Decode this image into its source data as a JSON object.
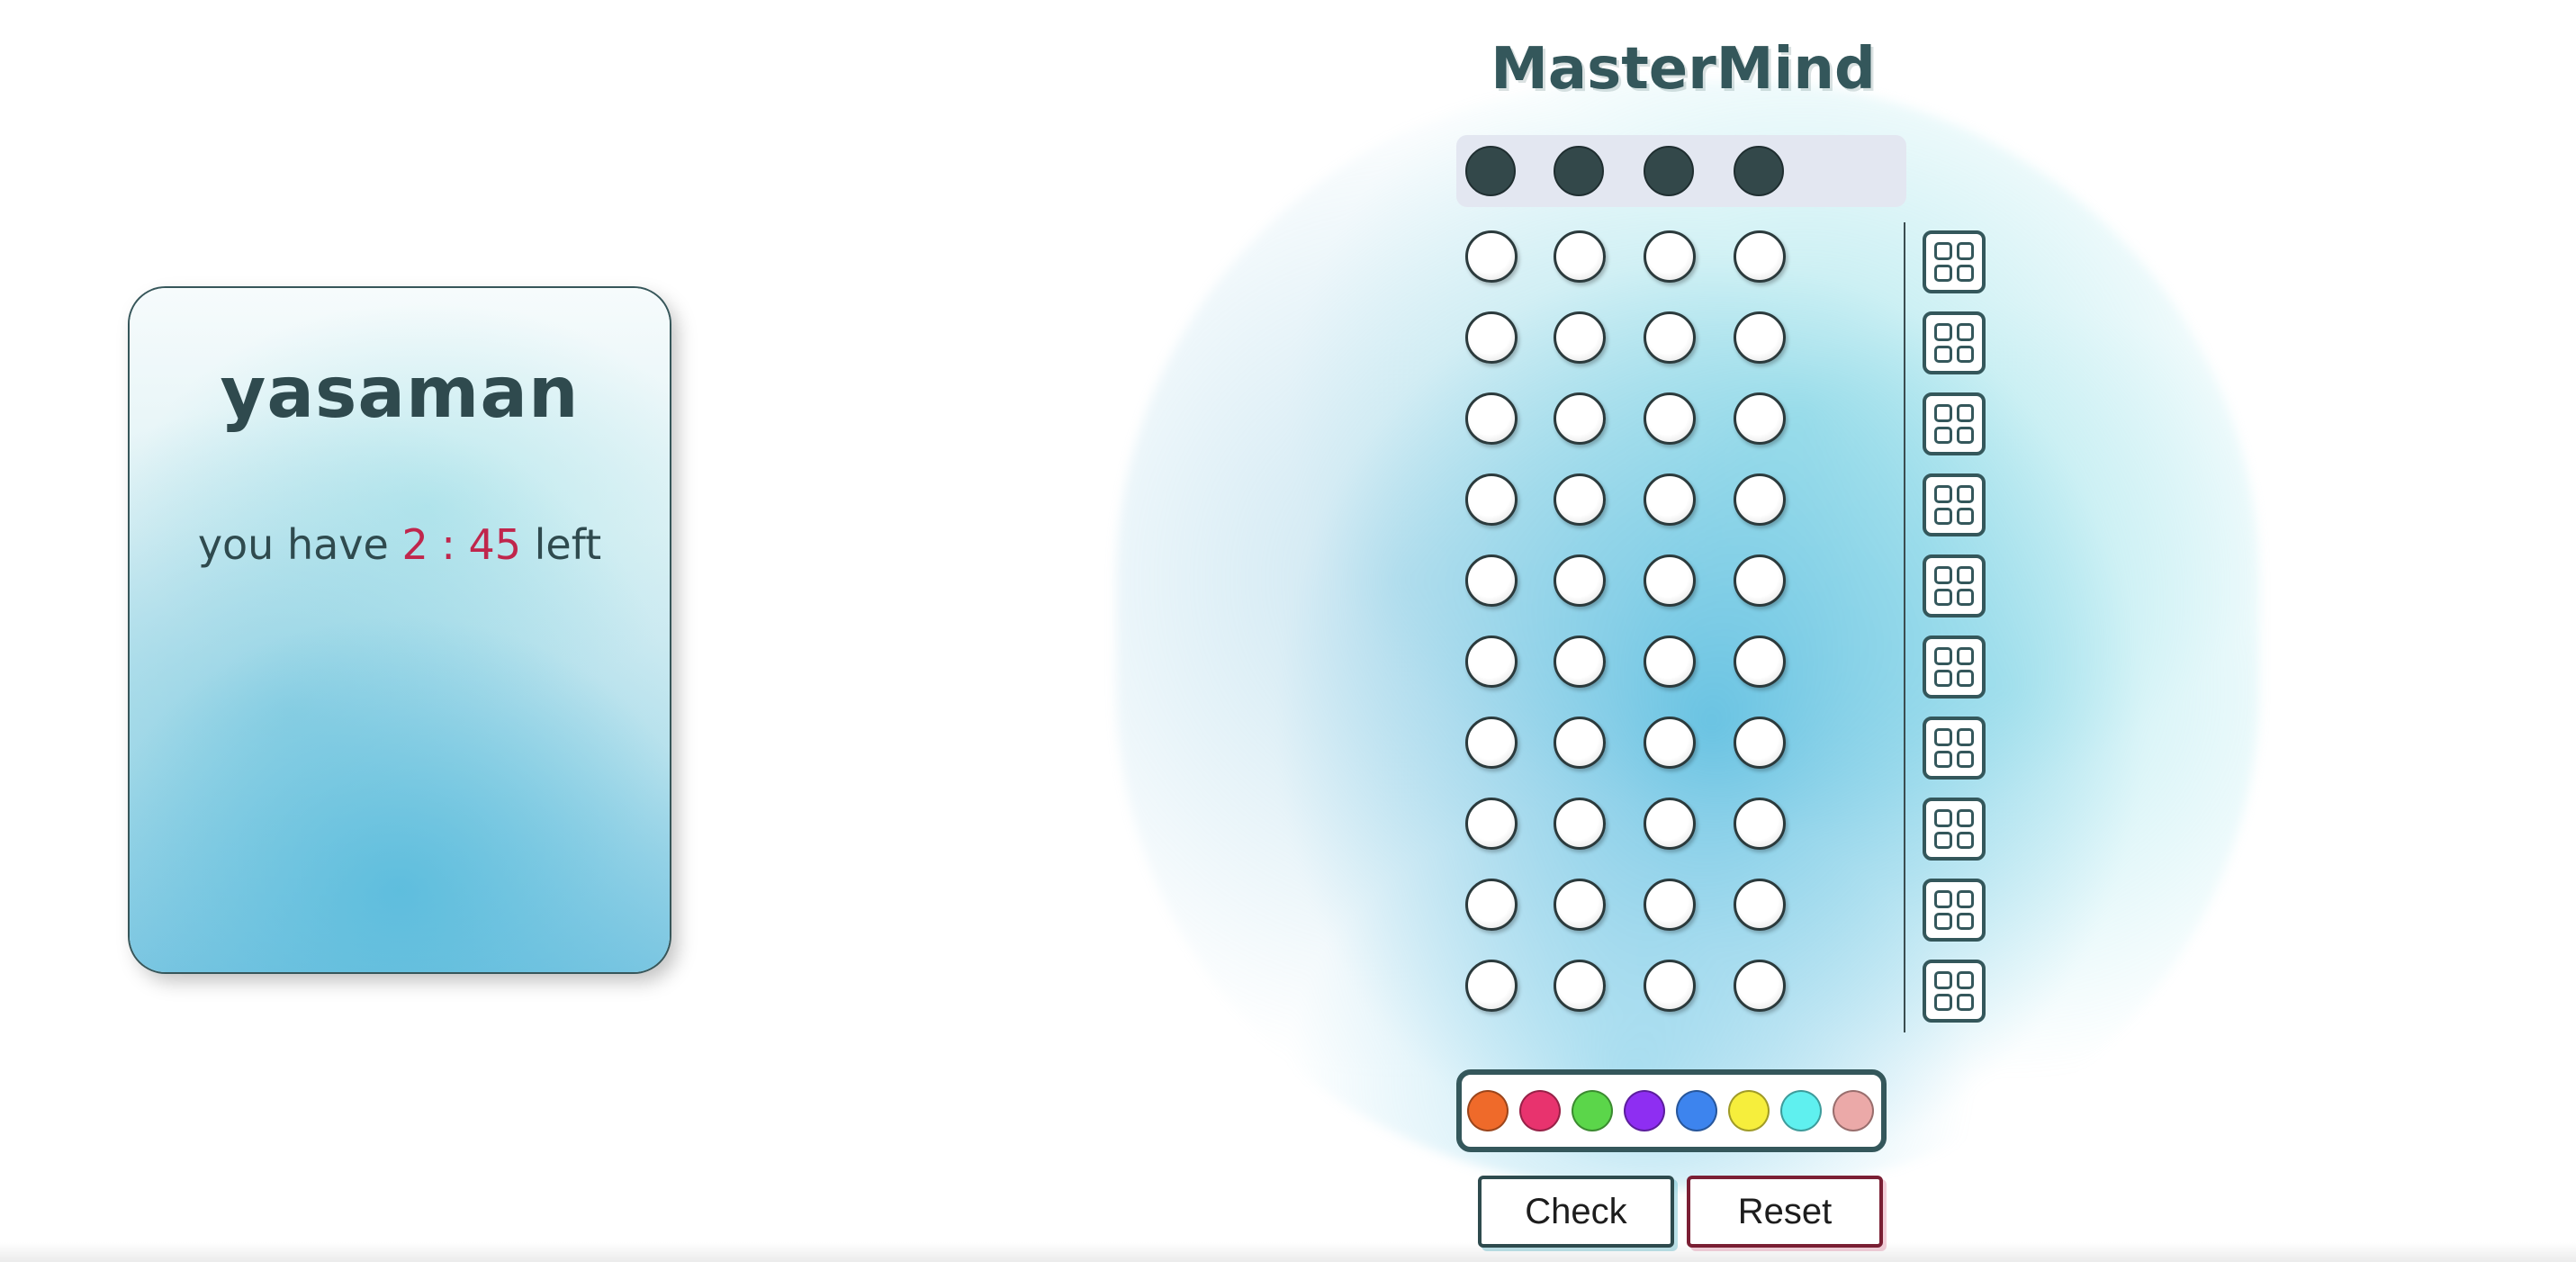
{
  "player": {
    "name": "yasaman",
    "timer_prefix": "you have",
    "minutes": "2",
    "separator": ":",
    "seconds": "45",
    "timer_suffix": "left"
  },
  "game": {
    "title": "MasterMind",
    "secret_pegs": 4,
    "rows": 10,
    "pegs_per_row": 4,
    "peg_state": "empty"
  },
  "palette": {
    "colors": [
      {
        "name": "orange",
        "hex": "#ef6a2a"
      },
      {
        "name": "pink",
        "hex": "#e8336e"
      },
      {
        "name": "green",
        "hex": "#5bd64a"
      },
      {
        "name": "purple",
        "hex": "#8e2ef2"
      },
      {
        "name": "blue",
        "hex": "#3d84ee"
      },
      {
        "name": "yellow",
        "hex": "#f6ee3c"
      },
      {
        "name": "cyan",
        "hex": "#5ff0ef"
      },
      {
        "name": "salmon",
        "hex": "#eba9a8"
      }
    ]
  },
  "buttons": {
    "check_label": "Check",
    "reset_label": "Reset"
  },
  "theme": {
    "text": "#2f4a4e",
    "timer_accent": "#c0264c",
    "secret_peg": "#33484a"
  }
}
